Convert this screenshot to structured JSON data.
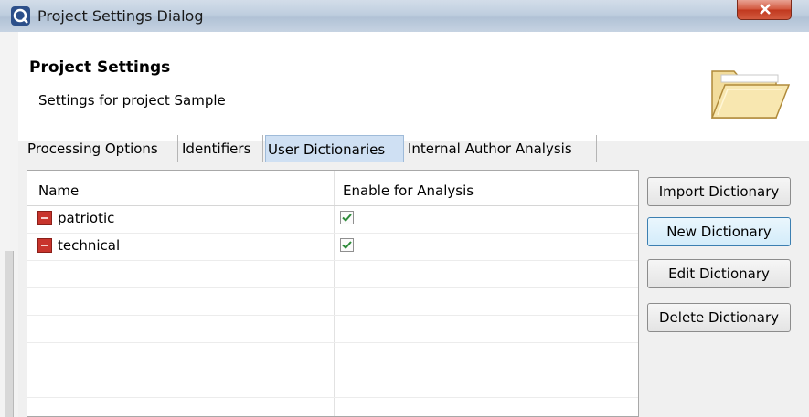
{
  "window": {
    "title": "Project Settings Dialog",
    "app_icon": "dialog-app-icon",
    "close_icon": "close-icon"
  },
  "header": {
    "title": "Project Settings",
    "subtitle": "Settings for project Sample",
    "icon": "folder-open-icon"
  },
  "tabs": [
    {
      "label": "Processing Options",
      "active": false
    },
    {
      "label": "Identifiers",
      "active": false
    },
    {
      "label": "User Dictionaries",
      "active": true
    },
    {
      "label": "Internal Author Analysis",
      "active": false
    }
  ],
  "table": {
    "columns": [
      "Name",
      "Enable for Analysis"
    ],
    "rows": [
      {
        "name": "patriotic",
        "enabled": true,
        "icon": "dictionary-icon"
      },
      {
        "name": "technical",
        "enabled": true,
        "icon": "dictionary-icon"
      }
    ]
  },
  "buttons": {
    "import": "Import Dictionary",
    "new": "New Dictionary",
    "edit": "Edit Dictionary",
    "delete": "Delete Dictionary"
  },
  "colors": {
    "active_tab": "#cfe0f3",
    "close_button": "#c0381e",
    "checkmark": "#2e8b3a",
    "dict_icon": "#c8342c"
  }
}
